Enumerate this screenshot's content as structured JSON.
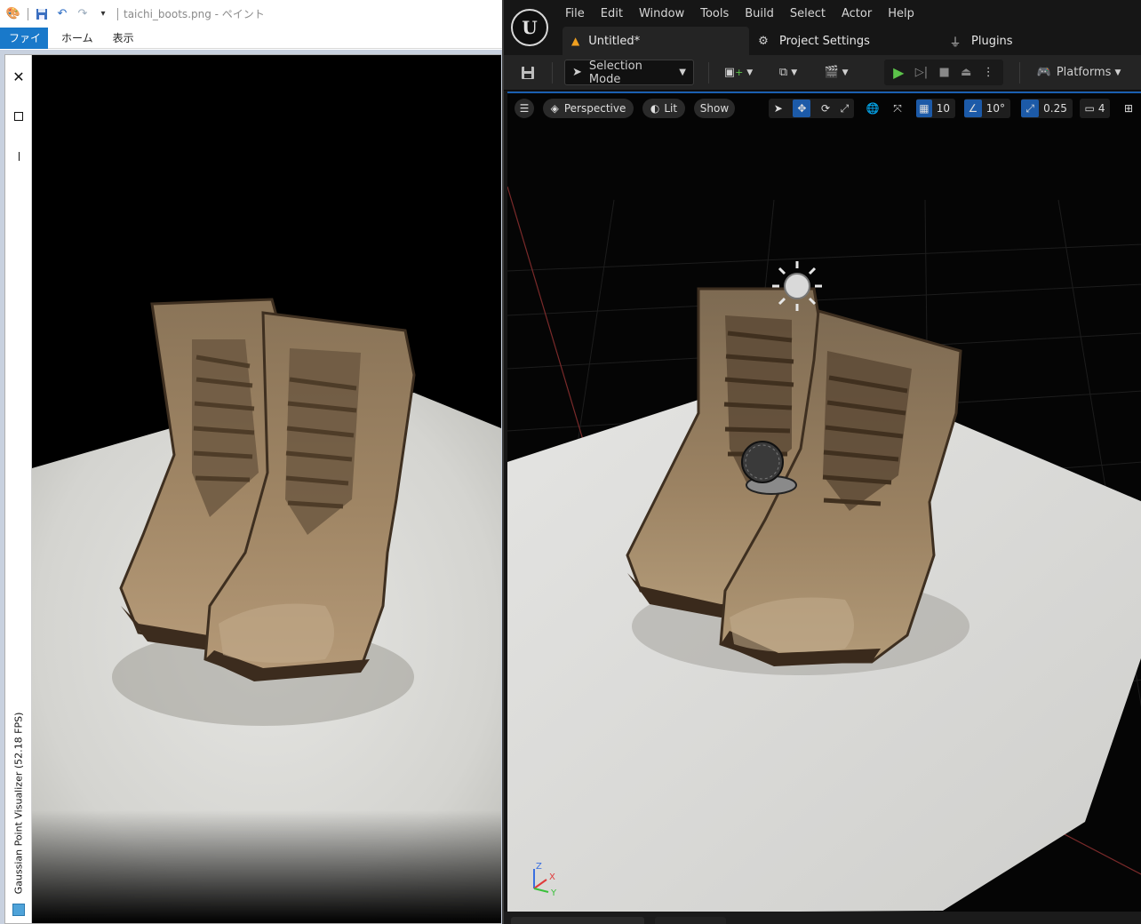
{
  "paint": {
    "window_title": "taichi_boots.png - ペイント",
    "ribbon_tabs": [
      "ファイル",
      "ホーム",
      "表示"
    ]
  },
  "visualizer": {
    "title": "Gaussian Point Visualizer (52.18 FPS)"
  },
  "unreal": {
    "menu": [
      "File",
      "Edit",
      "Window",
      "Tools",
      "Build",
      "Select",
      "Actor",
      "Help"
    ],
    "tabs": {
      "level": "Untitled*",
      "project_settings": "Project Settings",
      "plugins": "Plugins"
    },
    "toolbar": {
      "selection_mode": "Selection Mode",
      "platforms": "Platforms"
    },
    "viewport": {
      "perspective": "Perspective",
      "lit": "Lit",
      "show": "Show",
      "grid_snap": "10",
      "rotation_snap": "10°",
      "scale_snap": "0.25",
      "camera_speed": "4"
    },
    "axis_labels": [
      "Z",
      "X",
      "Y"
    ],
    "accent_color": "#1c5aa8",
    "play_color": "#5cc34a"
  }
}
